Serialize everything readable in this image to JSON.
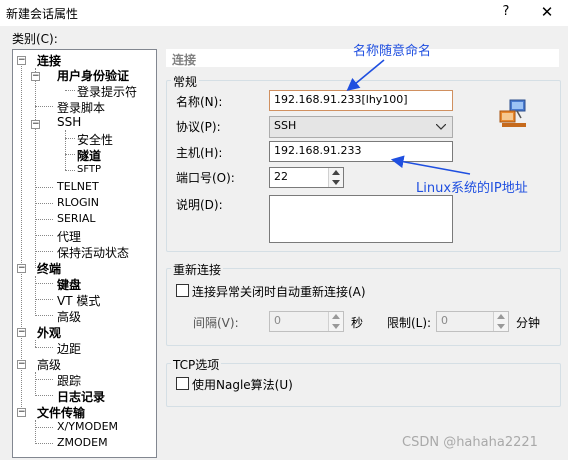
{
  "window": {
    "title": "新建会话属性",
    "help_glyph": "?",
    "close_glyph": "✕"
  },
  "category_label": "类别(C):",
  "tree": {
    "connection": "连接",
    "auth": "用户身份验证",
    "login_prompt": "登录提示符",
    "login_script": "登录脚本",
    "ssh": "SSH",
    "security": "安全性",
    "tunnel": "隧道",
    "sftp": "SFTP",
    "telnet": "TELNET",
    "rlogin": "RLOGIN",
    "serial": "SERIAL",
    "proxy": "代理",
    "keepalive": "保持活动状态",
    "terminal": "终端",
    "keyboard": "键盘",
    "vt_mode": "VT 模式",
    "advanced_term": "高级",
    "appearance": "外观",
    "margin": "边距",
    "advanced": "高级",
    "trace": "跟踪",
    "log": "日志记录",
    "file_transfer": "文件传输",
    "xymodem": "X/YMODEM",
    "zmodem": "ZMODEM"
  },
  "content_header": "连接",
  "general": {
    "group_title": "常规",
    "name_label": "名称(N):",
    "name_value": "192.168.91.233[lhy100]",
    "protocol_label": "协议(P):",
    "protocol_value": "SSH",
    "host_label": "主机(H):",
    "host_value": "192.168.91.233",
    "port_label": "端口号(O):",
    "port_value": "22",
    "desc_label": "说明(D):",
    "desc_value": ""
  },
  "reconnect": {
    "group_title": "重新连接",
    "auto_reconnect_label": "连接异常关闭时自动重新连接(A)",
    "interval_label": "间隔(V):",
    "interval_value": "0",
    "seconds_unit": "秒",
    "limit_label": "限制(L):",
    "limit_value": "0",
    "minutes_unit": "分钟"
  },
  "tcp": {
    "group_title": "TCP选项",
    "nagle_label": "使用Nagle算法(U)"
  },
  "annotations": {
    "name_note": "名称随意命名",
    "host_note": "Linux系统的IP地址",
    "color": "#1f4fe0"
  },
  "watermark": "CSDN @hahaha2221",
  "icons": [
    "question-mark-icon",
    "close-icon",
    "network-computers-icon",
    "chevron-down-icon",
    "spin-up-icon",
    "spin-down-icon",
    "tree-expander-icon"
  ]
}
